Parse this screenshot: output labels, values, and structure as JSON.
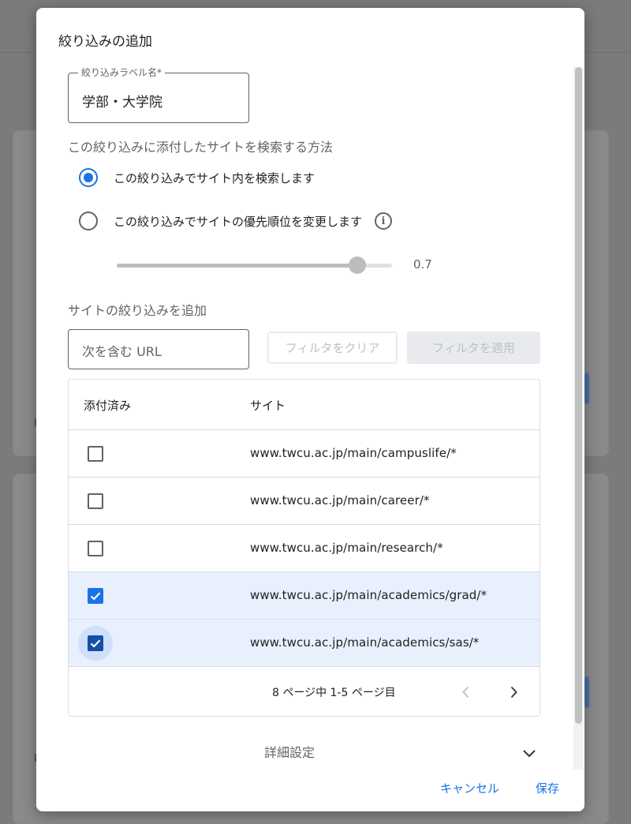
{
  "dialog": {
    "title": "絞り込みの追加"
  },
  "label_field": {
    "label": "絞り込みラベル名*",
    "value": "学部・大学院"
  },
  "search_method": {
    "heading": "この絞り込みに添付したサイトを検索する方法",
    "options": [
      {
        "label": "この絞り込みでサイト内を検索します",
        "selected": true
      },
      {
        "label": "この絞り込みでサイトの優先順位を変更します",
        "selected": false,
        "info_icon": "info-icon"
      }
    ],
    "slider": {
      "value": 0.7,
      "display": "0.7"
    }
  },
  "site_filter": {
    "heading": "サイトの絞り込みを追加",
    "url_placeholder": "次を含む URL",
    "clear_button": "フィルタをクリア",
    "apply_button": "フィルタを適用"
  },
  "table": {
    "columns": [
      "添付済み",
      "サイト"
    ],
    "rows": [
      {
        "site": "www.twcu.ac.jp/main/campuslife/*",
        "attached": false
      },
      {
        "site": "www.twcu.ac.jp/main/career/*",
        "attached": false
      },
      {
        "site": "www.twcu.ac.jp/main/research/*",
        "attached": false
      },
      {
        "site": "www.twcu.ac.jp/main/academics/grad/*",
        "attached": true
      },
      {
        "site": "www.twcu.ac.jp/main/academics/sas/*",
        "attached": true
      }
    ],
    "pagination": {
      "text": "8 ページ中 1-5 ページ目",
      "prev_icon": "chevron-left-icon",
      "next_icon": "chevron-right-icon"
    }
  },
  "advanced": {
    "label": "詳細設定",
    "icon": "chevron-down-icon"
  },
  "footer": {
    "cancel": "キャンセル",
    "save": "保存"
  },
  "colors": {
    "accent": "#1a73e8",
    "selected_row": "#e8f0fe",
    "overlay": "#7b7b7b"
  }
}
